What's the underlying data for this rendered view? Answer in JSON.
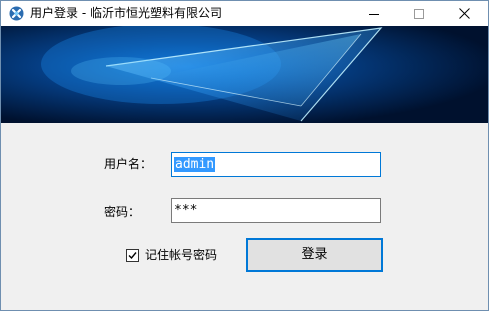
{
  "window": {
    "title": "用户登录 - 临沂市恒光塑料有限公司",
    "icon": "app-logo-icon",
    "controls": {
      "minimize_icon": "minimize-icon",
      "maximize_icon": "maximize-icon",
      "close_icon": "close-icon"
    }
  },
  "banner": {
    "image": "blue-abstract-glass-banner"
  },
  "form": {
    "username_label": "用户名：",
    "username_value": "admin",
    "password_label": "密码：",
    "password_value": "***",
    "remember_label": "记住帐号密码",
    "remember_checked": true,
    "login_label": "登录"
  },
  "colors": {
    "accent": "#0078d7",
    "selection": "#3399ff",
    "window_bg": "#f0f0f0",
    "button_bg": "#e1e1e1"
  }
}
